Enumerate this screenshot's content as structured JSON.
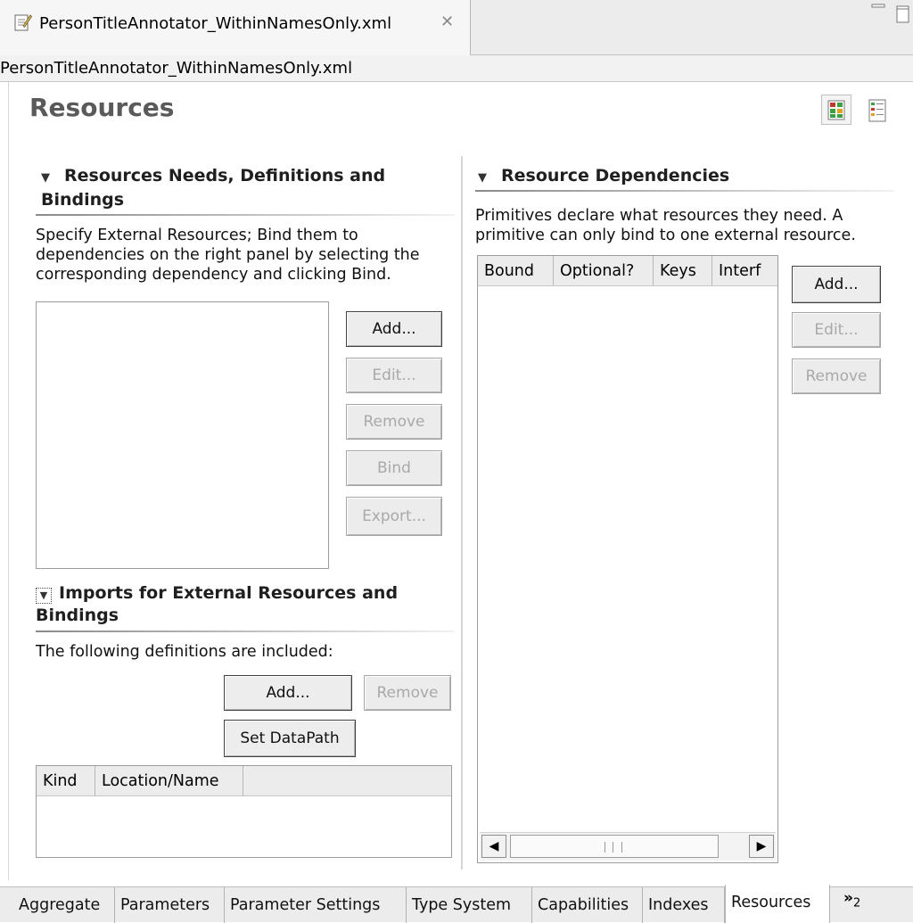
{
  "editor_tab": {
    "title": "PersonTitleAnnotator_WithinNamesOnly.xml",
    "close_glyph": "✕"
  },
  "path_label": "PersonTitleAnnotator_WithinNamesOnly.xml",
  "page_title": "Resources",
  "left_section": {
    "title": "Resources Needs, Definitions and Bindings",
    "description": "Specify External Resources; Bind them to dependencies on the right panel by selecting the corresponding dependency and clicking Bind.",
    "buttons": {
      "add": "Add...",
      "edit": "Edit...",
      "remove": "Remove",
      "bind": "Bind",
      "export": "Export..."
    }
  },
  "imports_section": {
    "title": "Imports for External Resources and Bindings",
    "description": "The following definitions are included:",
    "buttons": {
      "add": "Add...",
      "remove": "Remove",
      "set_datapath": "Set DataPath"
    },
    "columns": [
      "Kind",
      "Location/Name"
    ]
  },
  "right_section": {
    "title": "Resource Dependencies",
    "description": "Primitives declare what resources they need. A primitive can only bind to one external resource.",
    "columns": [
      "Bound",
      "Optional?",
      "Keys",
      "Interf"
    ],
    "buttons": {
      "add": "Add...",
      "edit": "Edit...",
      "remove": "Remove"
    }
  },
  "bottom_tabs": [
    "Aggregate",
    "Parameters",
    "Parameter Settings",
    "Type System",
    "Capabilities",
    "Indexes",
    "Resources"
  ],
  "active_tab": "Resources",
  "more_tabs": {
    "glyph": "»",
    "count": "2"
  },
  "colors": {
    "page_title": "#5a5a5a",
    "disabled_text": "#a9a9a9",
    "tab_background": "#ececec"
  }
}
